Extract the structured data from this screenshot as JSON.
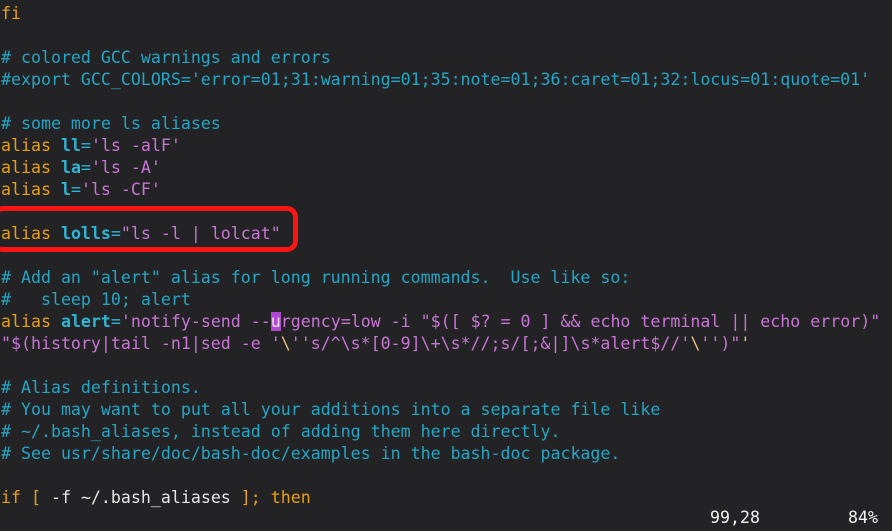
{
  "editor": {
    "app": "vim",
    "file_type": "bash",
    "background_color": "#232326",
    "foreground_color": "#e8e8e8",
    "comment_color": "#26a5c4",
    "keyword_color": "#e8a019",
    "identifier_color": "#2fb5d6",
    "string_color": "#c975d6",
    "cursor_color": "#b048d0",
    "annotation_color": "#fa1414"
  },
  "lines": [
    {
      "id": "l1",
      "text": "fi"
    },
    {
      "id": "l2",
      "text": ""
    },
    {
      "id": "l3",
      "text": "# colored GCC warnings and errors"
    },
    {
      "id": "l4",
      "text": "#export GCC_COLORS='error=01;31:warning=01;35:note=01;36:caret=01;32:locus=01:quote=01'"
    },
    {
      "id": "l5",
      "text": ""
    },
    {
      "id": "l6",
      "text": "# some more ls aliases"
    },
    {
      "id": "l7",
      "text": "alias ll='ls -alF'"
    },
    {
      "id": "l8",
      "text": "alias la='ls -A'"
    },
    {
      "id": "l9",
      "text": "alias l='ls -CF'"
    },
    {
      "id": "l10",
      "text": ""
    },
    {
      "id": "l11",
      "text": "alias lolls=\"ls -l | lolcat\""
    },
    {
      "id": "l12",
      "text": ""
    },
    {
      "id": "l13",
      "text": "# Add an \"alert\" alias for long running commands.  Use like so:"
    },
    {
      "id": "l14",
      "text": "#   sleep 10; alert"
    },
    {
      "id": "l15",
      "text": "alias alert='notify-send --urgency=low -i \"$([ $? = 0 ] && echo terminal || echo error)\""
    },
    {
      "id": "l16",
      "text": "\"$(history|tail -n1|sed -e '\\''s/^\\s*[0-9]\\+\\s*//;s/[;&|]\\s*alert$//'\\'')\"'"
    },
    {
      "id": "l17",
      "text": ""
    },
    {
      "id": "l18",
      "text": "# Alias definitions."
    },
    {
      "id": "l19",
      "text": "# You may want to put all your additions into a separate file like"
    },
    {
      "id": "l20",
      "text": "# ~/.bash_aliases, instead of adding them here directly."
    },
    {
      "id": "l21",
      "text": "# See usr/share/doc/bash-doc/examples in the bash-doc package."
    },
    {
      "id": "l22",
      "text": ""
    },
    {
      "id": "l23",
      "text": "if [ -f ~/.bash_aliases ]; then"
    }
  ],
  "tokens": {
    "fi": "fi",
    "comment_gcc_header": "# colored GCC warnings and errors",
    "comment_gcc_export": "#export GCC_COLORS='error=01;31:warning=01;35:note=01;36:caret=01;32:locus=01:quote=01'",
    "comment_ls_aliases": "# some more ls aliases",
    "comment_alert_1": "# Add an \"alert\" alias for long running commands.  Use like so:",
    "comment_alert_2": "#   sleep 10; alert",
    "comment_defs_1": "# Alias definitions.",
    "comment_defs_2": "# You may want to put all your additions into a separate file like",
    "comment_defs_3": "# ~/.bash_aliases, instead of adding them here directly.",
    "comment_defs_4": "# See usr/share/doc/bash-doc/examples in the bash-doc package.",
    "kw_alias": "alias ",
    "name_ll": "ll",
    "name_la": "la",
    "name_l": "l",
    "name_lolls": "lolls",
    "name_alert": "alert",
    "eq": "=",
    "str_ll": "'ls -alF'",
    "str_la": "'ls -A'",
    "str_l": "'ls -CF'",
    "str_lolls": "\"ls -l | lolcat\"",
    "alert_pre": "'notify-send --",
    "alert_cursor_char": "u",
    "alert_post": "rgency=low -i \"$([ $? = 0 ] && echo terminal || echo error)\"",
    "alert_cont_a": "\"$(history|tail -n1|sed -e '",
    "alert_cont_esc1": "\\",
    "alert_cont_b": "''s/^\\s*[0-9]\\+\\s*//;s/[;&|]\\s*alert$//'",
    "alert_cont_esc2": "\\",
    "alert_cont_c": "''",
    "alert_cont_d": ")\"",
    "alert_cont_e": "'",
    "if_kw": "if ",
    "if_br_open": "[",
    "if_cond": " -f ~/.bash_aliases ",
    "if_br_close": "]",
    "if_semi": "; ",
    "then_kw": "then"
  },
  "status": {
    "ruler": "99,28",
    "percent": "84%"
  },
  "annotation": {
    "label": "red-highlight-box",
    "target_line": "alias lolls=\"ls -l | lolcat\"",
    "color": "#fa1414"
  }
}
